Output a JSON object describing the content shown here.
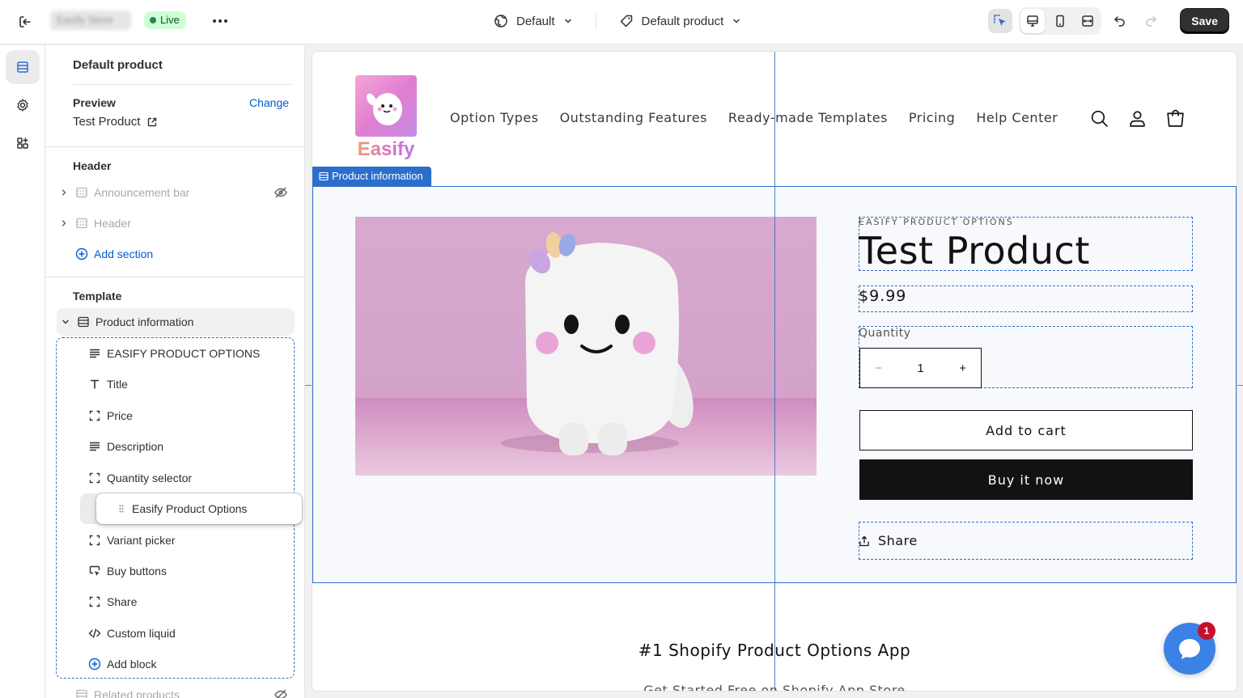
{
  "topbar": {
    "store_name": "Easify Store",
    "status": "Live",
    "more": "•••",
    "theme": "Default",
    "template": "Default product",
    "save_label": "Save"
  },
  "sidebar": {
    "title": "Default product",
    "preview_label": "Preview",
    "change_label": "Change",
    "preview_value": "Test Product",
    "header_section": "Header",
    "header_items": [
      {
        "label": "Announcement bar"
      },
      {
        "label": "Header"
      }
    ],
    "add_section": "Add section",
    "template_section": "Template",
    "product_information": "Product information",
    "blocks": [
      {
        "label": "EASIFY PRODUCT OPTIONS",
        "icon": "text-align-icon"
      },
      {
        "label": "Title",
        "icon": "type-icon"
      },
      {
        "label": "Price",
        "icon": "frame-icon"
      },
      {
        "label": "Description",
        "icon": "text-align-icon"
      },
      {
        "label": "Quantity selector",
        "icon": "frame-icon"
      },
      {
        "label": "Variant picker",
        "icon": "frame-icon"
      },
      {
        "label": "Buy buttons",
        "icon": "cursor-card-icon"
      },
      {
        "label": "Share",
        "icon": "frame-icon"
      },
      {
        "label": "Custom liquid",
        "icon": "code-icon"
      }
    ],
    "dragging_block": "Easify Product Options",
    "add_block": "Add block",
    "related_products": "Related products"
  },
  "site": {
    "logo_text": "Easify",
    "nav": [
      "Option Types",
      "Outstanding Features",
      "Ready-made Templates",
      "Pricing",
      "Help Center"
    ],
    "section_tag": "Product information",
    "vendor": "EASIFY PRODUCT OPTIONS",
    "product_title": "Test Product",
    "price": "$9.99",
    "quantity_label": "Quantity",
    "quantity_minus": "−",
    "quantity_value": "1",
    "quantity_plus": "+",
    "add_to_cart": "Add to cart",
    "buy_now": "Buy it now",
    "share": "Share",
    "app_heading": "#1 Shopify Product Options App",
    "app_subheading": "Get Started Free on Shopify App Store",
    "chat_badge": "1"
  },
  "colors": {
    "accent": "#2c6ecb",
    "link": "#005bd3",
    "live_bg": "#cdfed4",
    "button_dark": "#121212"
  }
}
